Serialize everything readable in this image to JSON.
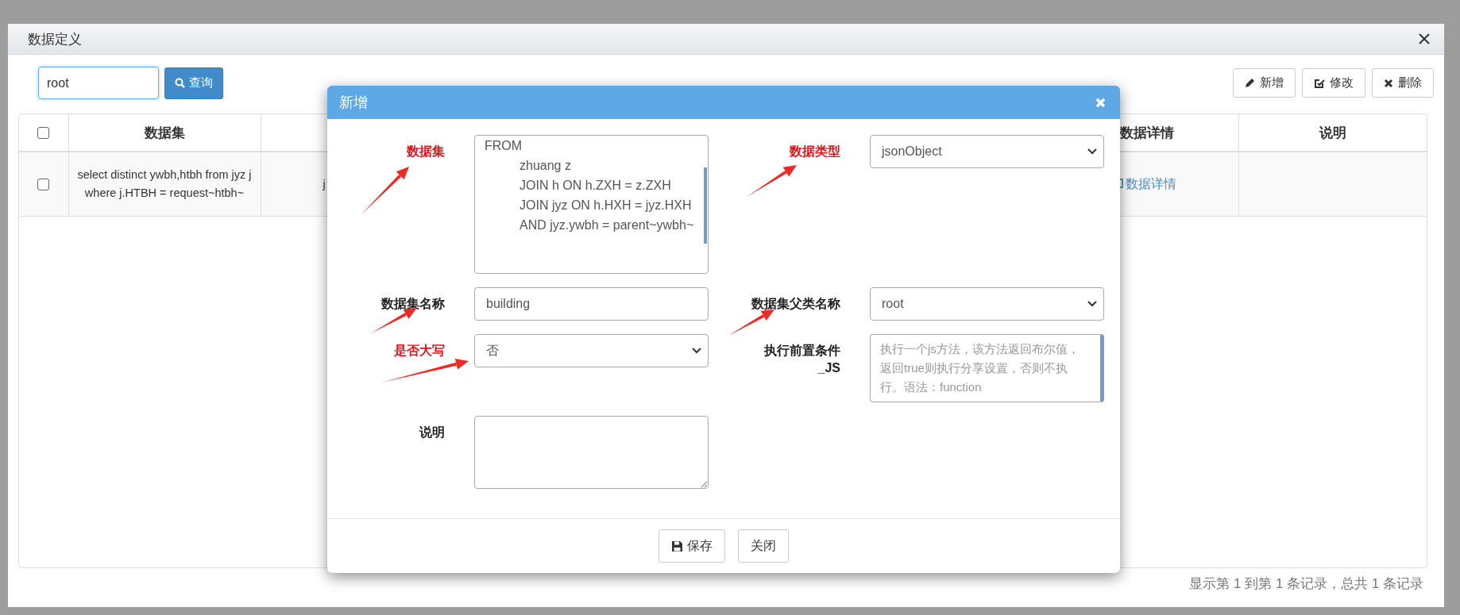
{
  "dialog": {
    "title": "数据定义"
  },
  "search": {
    "value": "root",
    "button": "查询"
  },
  "toolbar": [
    {
      "label": "新增",
      "kind": "add"
    },
    {
      "label": "修改",
      "kind": "edit"
    },
    {
      "label": "删除",
      "kind": "delete"
    }
  ],
  "table": {
    "header_checkbox": {
      "checked": false
    },
    "columns": [
      {
        "kind": "text",
        "label": "数据集"
      },
      {
        "kind": "blank"
      },
      {
        "kind": "text",
        "label": "数据详情"
      },
      {
        "kind": "text",
        "label": "说明"
      }
    ],
    "rows": [
      {
        "checked": false,
        "dataset": "select distinct ywbh,htbh from jyz j where j.HTBH = request~htbh~",
        "column_3": "j",
        "details_link": "数据详情"
      }
    ]
  },
  "pagination": "显示第 1 到第 1 条记录，总共 1 条记录",
  "modal": {
    "title": "新增",
    "fields": [
      {
        "label": "数据集",
        "kind": "code",
        "value": "FROM\n\tzhuang z\n\tJOIN h ON h.ZXH = z.ZXH\n\tJOIN jyz ON h.HXH = jyz.HXH\n\tAND jyz.ywbh = parent~ywbh~",
        "highlight": true
      },
      {
        "label": "数据类型",
        "kind": "select",
        "value": "jsonObject",
        "highlight": true
      },
      {
        "label": "数据集名称",
        "kind": "input",
        "value": "building",
        "highlight": false
      },
      {
        "label": "数据集父类名称",
        "kind": "select",
        "value": "root",
        "highlight": false
      },
      {
        "label": "是否大写",
        "kind": "select",
        "value": "否",
        "highlight": true
      },
      {
        "label": "执行前置条件_JS",
        "kind": "textarea",
        "placeholder": "执行一个js方法，该方法返回布尔值，返回true则执行分享设置，否则不执行。语法：function",
        "highlight": false
      },
      {
        "label": "说明",
        "kind": "textarea",
        "highlight": false
      }
    ],
    "buttons": [
      {
        "label": "保存",
        "kind": "save"
      },
      {
        "label": "关闭",
        "kind": "plain"
      }
    ]
  }
}
